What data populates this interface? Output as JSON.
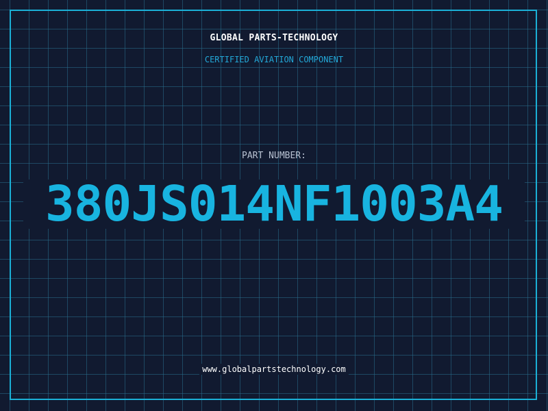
{
  "header": {
    "company": "GLOBAL PARTS-TECHNOLOGY",
    "subtitle": "CERTIFIED AVIATION COMPONENT"
  },
  "part": {
    "label": "PART NUMBER:",
    "number": "380JS014NF1003A4"
  },
  "footer": {
    "website": "www.globalpartstechnology.com"
  },
  "colors": {
    "background": "#111a30",
    "grid": "#286e8c",
    "frame": "#1bb0d6",
    "accent": "#18b4e0",
    "text": "#ffffff",
    "label": "#b8c2d2"
  }
}
